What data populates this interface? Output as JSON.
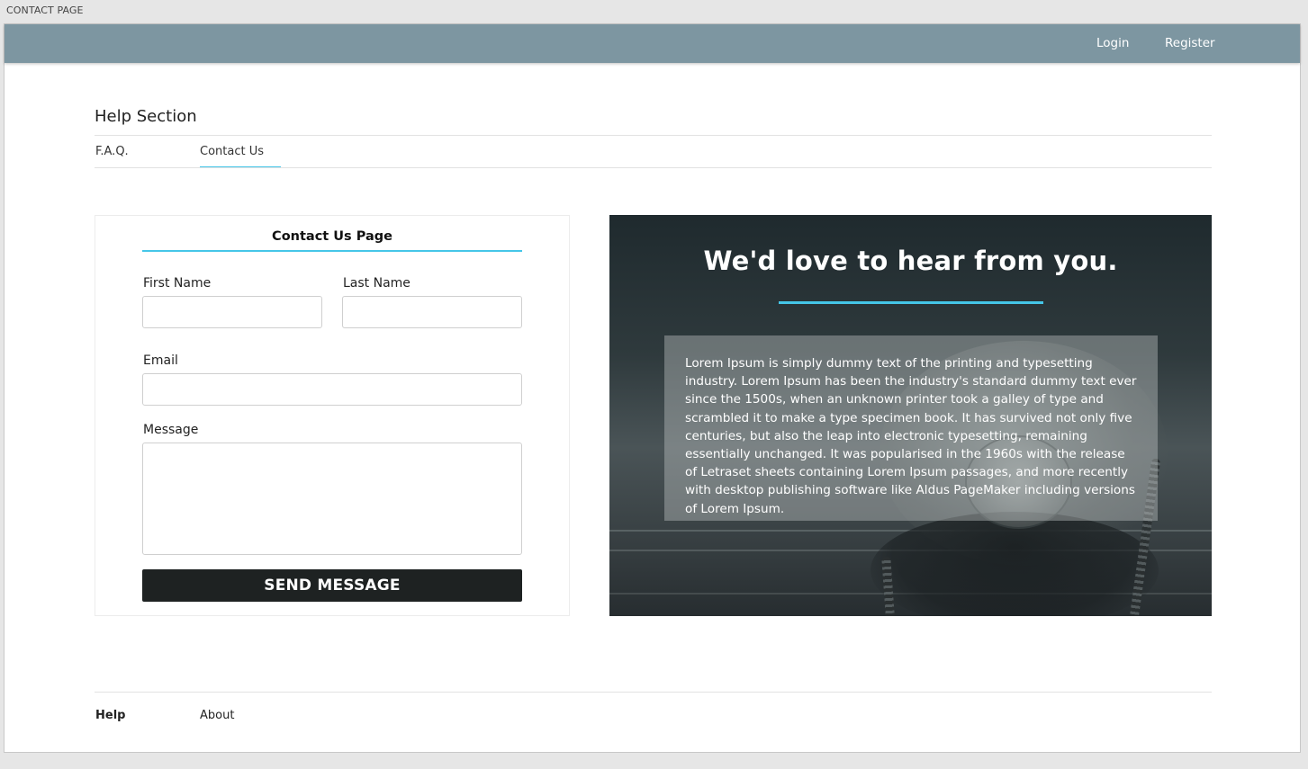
{
  "window": {
    "title": "CONTACT PAGE"
  },
  "topbar": {
    "links": [
      {
        "label": "Login"
      },
      {
        "label": "Register"
      }
    ],
    "colors": {
      "background": "#7d96a1"
    }
  },
  "help": {
    "title": "Help Section",
    "tabs": [
      {
        "label": "F.A.Q.",
        "active": false
      },
      {
        "label": "Contact Us",
        "active": true
      }
    ]
  },
  "form": {
    "title": "Contact Us Page",
    "first_name": {
      "label": "First Name",
      "value": "",
      "placeholder": ""
    },
    "last_name": {
      "label": "Last Name",
      "value": "",
      "placeholder": ""
    },
    "email": {
      "label": "Email",
      "value": "",
      "placeholder": ""
    },
    "message": {
      "label": "Message",
      "value": "",
      "placeholder": ""
    },
    "submit_label": "SEND MESSAGE"
  },
  "hero": {
    "title": "We'd love to hear from you.",
    "body": "Lorem Ipsum is simply dummy text of the printing and typesetting industry. Lorem Ipsum has been the industry's standard dummy text ever since the 1500s, when an unknown printer took a galley of type and scrambled it to make a type specimen book. It has survived not only five centuries, but also the leap into electronic typesetting, remaining essentially unchanged. It was popularised in the 1960s with the release of Letraset sheets containing Lorem Ipsum passages, and more recently with desktop publishing software like Aldus PageMaker including versions of Lorem Ipsum.",
    "image": "telephone-photo"
  },
  "footer": {
    "links": [
      {
        "label": "Help",
        "active": true
      },
      {
        "label": "About",
        "active": false
      }
    ]
  },
  "colors": {
    "accent": "#45c6e8",
    "button": "#1e2222"
  }
}
